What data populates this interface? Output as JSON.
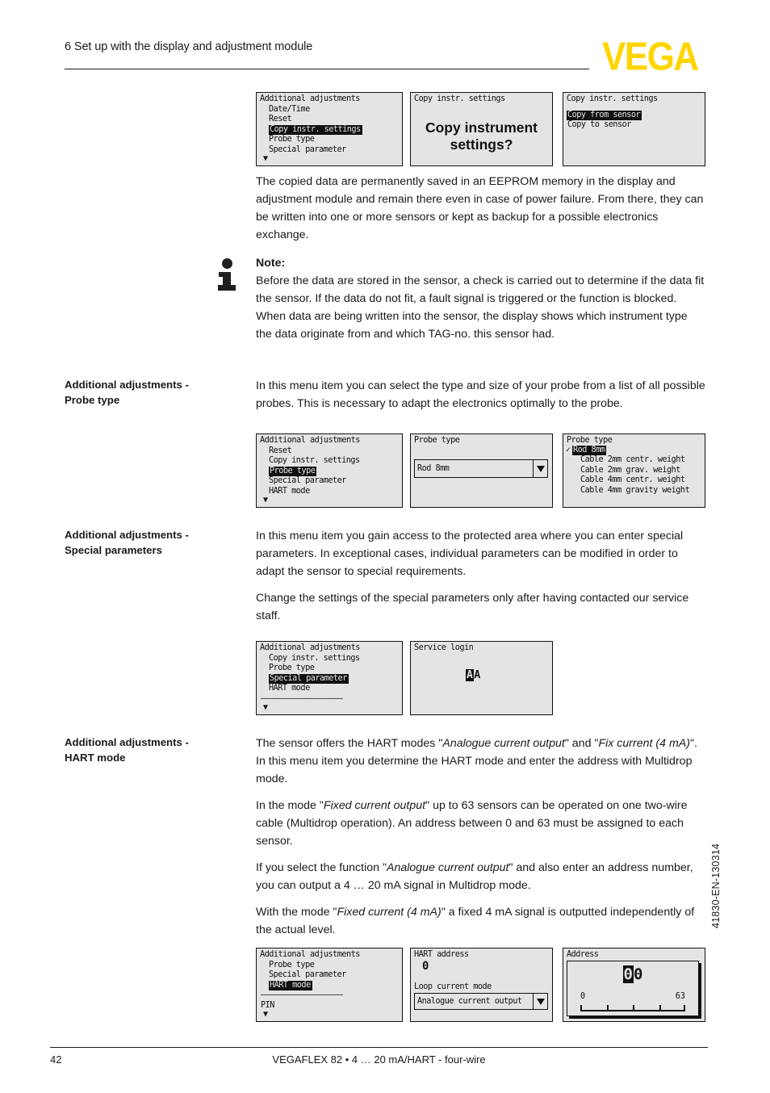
{
  "header": {
    "chapter_title": "6 Set up with the display and adjustment module",
    "logo_text": "VEGA",
    "logo_color": "#ffd500"
  },
  "footer": {
    "page_number": "42",
    "document_title": "VEGAFLEX 82 • 4 … 20 mA/HART - four-wire",
    "doc_code": "41830-EN-130314"
  },
  "sections": {
    "copy_settings": {
      "paragraph": "The copied data are permanently saved in an EEPROM memory in the display and adjustment module and remain there even in case of power failure. From there, they can be written into one or more sensors or kept as backup for a possible electronics exchange.",
      "note_label": "Note:",
      "note_text": "Before the data are stored in the sensor, a check is carried out to determine if the data fit the sensor. If the data do not fit, a fault signal is triggered or the function is blocked. When data are being written into the sensor, the display shows which instrument type the data originate from and which TAG-no. this sensor had.",
      "screens": [
        {
          "title": "Additional adjustments",
          "items": [
            "Date/Time",
            "Reset",
            "Copy instr. settings",
            "Probe type",
            "Special parameter"
          ],
          "selected_index": 2,
          "has_down_arrow": true
        },
        {
          "title": "Copy instr. settings",
          "big_text_line1": "Copy instrument",
          "big_text_line2": "settings?"
        },
        {
          "title": "Copy instr. settings",
          "items": [
            "Copy from sensor",
            "Copy to sensor"
          ],
          "selected_index": 0
        }
      ]
    },
    "probe_type": {
      "label_line1": "Additional adjustments -",
      "label_line2": "Probe type",
      "paragraph": "In this menu item you can select the type and size of your probe from a list of all possible probes. This is necessary to adapt the electronics optimally to the probe.",
      "screens": [
        {
          "title": "Additional adjustments",
          "items": [
            "Reset",
            "Copy instr. settings",
            "Probe type",
            "Special parameter",
            "HART mode"
          ],
          "selected_index": 2,
          "has_down_arrow": true
        },
        {
          "title": "Probe type",
          "combo_value": "Rod 8mm"
        },
        {
          "title": "Probe type",
          "items": [
            "Rod 8mm",
            "Cable 2mm centr. weight",
            "Cable 2mm grav. weight",
            "Cable 4mm centr. weight",
            "Cable 4mm gravity weight"
          ],
          "selected_index": 0,
          "checked_index": 0
        }
      ]
    },
    "special_parameters": {
      "label_line1": "Additional adjustments -",
      "label_line2": "Special parameters",
      "paragraph1": "In this menu item you gain access to the protected area where you can enter special parameters. In exceptional cases, individual parameters can be modified in order to adapt the sensor to special requirements.",
      "paragraph2": "Change the settings of the special parameters only after having contacted our service staff.",
      "screens": [
        {
          "title": "Additional adjustments",
          "items": [
            "Copy instr. settings",
            "Probe type",
            "Special parameter",
            "HART mode"
          ],
          "selected_index": 2,
          "divider_after": 3,
          "has_down_arrow": true
        },
        {
          "title": "Service login",
          "password_chars": [
            "A",
            "A"
          ],
          "password_active_index": 0
        }
      ]
    },
    "hart_mode": {
      "label_line1": "Additional adjustments -",
      "label_line2": "HART mode",
      "paragraph1_a": "The sensor offers the HART modes \"",
      "paragraph1_it1": "Analogue current output",
      "paragraph1_b": "\" and \"",
      "paragraph1_it2": "Fix current (4 mA)",
      "paragraph1_c": "\". In this menu item you determine the HART mode and enter the address with  Multidrop mode.",
      "paragraph2_a": "In the mode \"",
      "paragraph2_it": "Fixed current output",
      "paragraph2_b": "\" up to 63 sensors can be operated on one two-wire cable (Multidrop operation). An address between 0 and 63 must be assigned to each sensor.",
      "paragraph3_a": "If you select the function \"",
      "paragraph3_it": "Analogue current output",
      "paragraph3_b": "\" and also enter an address number, you can output a 4 … 20 mA signal in Multidrop mode.",
      "paragraph4_a": "With the mode \"",
      "paragraph4_it": "Fixed current (4 mA)",
      "paragraph4_b": "\" a fixed 4 mA signal is outputted independently of the actual level.",
      "screens": [
        {
          "title": "Additional adjustments",
          "items": [
            "Probe type",
            "Special parameter",
            "HART mode",
            "PIN"
          ],
          "selected_index": 2,
          "divider_after": 2,
          "has_down_arrow": true
        },
        {
          "title": "HART address",
          "value": "0",
          "sub_label": "Loop current mode",
          "combo_value": "Analogue current output"
        },
        {
          "title": "Address",
          "digits": [
            "0",
            "0"
          ],
          "active_digit_index": 0,
          "scale_min": "0",
          "scale_max": "63"
        }
      ]
    }
  }
}
